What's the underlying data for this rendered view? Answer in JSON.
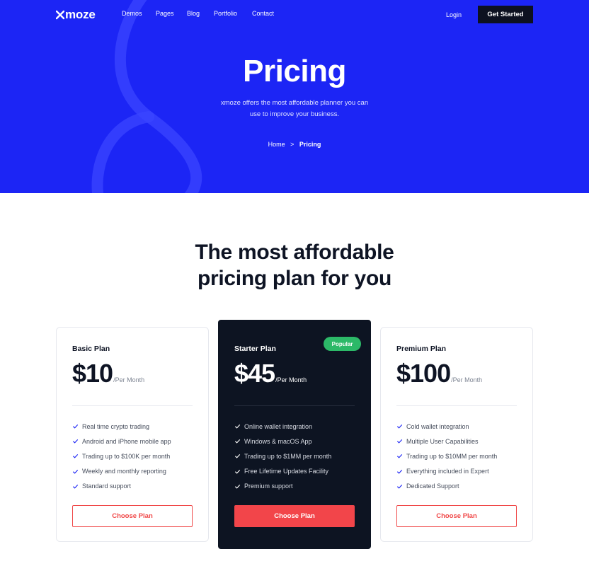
{
  "brand": {
    "name": "moze",
    "primary_color": "#1c25f5",
    "accent_color": "#f2454a",
    "badge_color": "#2cb968"
  },
  "nav": {
    "links": [
      "Demos",
      "Pages",
      "Blog",
      "Portfolio",
      "Contact"
    ],
    "login": "Login",
    "cta": "Get Started"
  },
  "hero": {
    "title": "Pricing",
    "subtitle_line1": "xmoze offers the most affordable planner you can",
    "subtitle_line2": "use to improve your business.",
    "breadcrumb": {
      "home": "Home",
      "separator": ">",
      "current": "Pricing"
    }
  },
  "section": {
    "title_line1": "The most affordable",
    "title_line2": "pricing plan for you"
  },
  "plans": [
    {
      "name": "Basic Plan",
      "price": "$10",
      "period": "/Per Month",
      "features": [
        "Real time crypto trading",
        "Android and iPhone mobile app",
        "Trading up to $100K per month",
        "Weekly and monthly reporting",
        "Standard support"
      ],
      "button": "Choose Plan"
    },
    {
      "name": "Starter Plan",
      "badge": "Popular",
      "price": "$45",
      "period": "/Per Month",
      "features": [
        "Online wallet integration",
        "Windows & macOS App",
        "Trading up to $1MM per month",
        "Free Lifetime Updates Facility",
        "Premium support"
      ],
      "button": "Choose Plan"
    },
    {
      "name": "Premium Plan",
      "price": "$100",
      "period": "/Per Month",
      "features": [
        "Cold wallet integration",
        "Multiple User Capabilities",
        "Trading up to $10MM per month",
        "Everything included in Expert",
        "Dedicated Support"
      ],
      "button": "Choose Plan"
    }
  ]
}
